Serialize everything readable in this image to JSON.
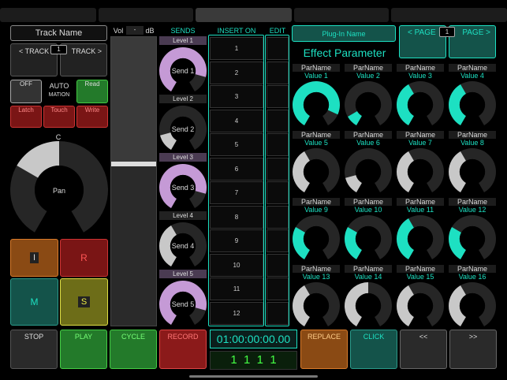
{
  "colors": {
    "accent": "#1de0c2",
    "send": "#c59ad6",
    "play": "#237a2a",
    "record": "#8b1a1a",
    "replace": "#8a4a14",
    "click": "#14534a"
  },
  "track": {
    "name": "Track Name",
    "prev": "< TRACK",
    "next": "TRACK >",
    "number": "1"
  },
  "automation": {
    "off": "OFF",
    "auto1": "AUTO",
    "auto2": "MATION",
    "read": "Read",
    "latch": "Latch",
    "touch": "Touch",
    "write": "Write"
  },
  "pan": {
    "top_label": "C",
    "label": "Pan",
    "value": 0.5
  },
  "channel_buttons": {
    "i": "I",
    "r": "R",
    "m": "M",
    "s": "S"
  },
  "fader": {
    "vol_label": "Vol",
    "value": "-",
    "unit": "dB",
    "level": 0.56
  },
  "sends": {
    "header": "SENDS",
    "items": [
      {
        "level": "Level 1",
        "label": "Send 1",
        "value": 0.85,
        "active": true
      },
      {
        "level": "Level 2",
        "label": "Send 2",
        "value": 0.15,
        "active": false
      },
      {
        "level": "Level 3",
        "label": "Send 3",
        "value": 0.85,
        "active": true
      },
      {
        "level": "Level 4",
        "label": "Send 4",
        "value": 0.4,
        "active": false
      },
      {
        "level": "Level 5",
        "label": "Send 5",
        "value": 0.85,
        "active": true
      }
    ]
  },
  "inserts": {
    "header": "INSERT ON",
    "edit_header": "EDIT",
    "slots": [
      "1",
      "2",
      "3",
      "4",
      "5",
      "6",
      "7",
      "8",
      "9",
      "10",
      "11",
      "12"
    ]
  },
  "plugin": {
    "name": "Plug-In Name",
    "page_prev": "< PAGE",
    "page_num": "1",
    "page_next": "PAGE >",
    "title": "Effect Parameter",
    "params": [
      {
        "name": "ParName",
        "value": "Value 1",
        "level": 0.88,
        "cyan": true
      },
      {
        "name": "ParName",
        "value": "Value 2",
        "level": 0.1,
        "cyan": true
      },
      {
        "name": "ParName",
        "value": "Value 3",
        "level": 0.4,
        "cyan": true
      },
      {
        "name": "ParName",
        "value": "Value 4",
        "level": 0.4,
        "cyan": true
      },
      {
        "name": "ParName",
        "value": "Value 5",
        "level": 0.4,
        "cyan": false
      },
      {
        "name": "ParName",
        "value": "Value 6",
        "level": 0.15,
        "cyan": false
      },
      {
        "name": "ParName",
        "value": "Value 7",
        "level": 0.4,
        "cyan": false
      },
      {
        "name": "ParName",
        "value": "Value 8",
        "level": 0.4,
        "cyan": false
      },
      {
        "name": "ParName",
        "value": "Value 9",
        "level": 0.3,
        "cyan": true
      },
      {
        "name": "ParName",
        "value": "Value 10",
        "level": 0.3,
        "cyan": true
      },
      {
        "name": "ParName",
        "value": "Value 11",
        "level": 0.4,
        "cyan": true
      },
      {
        "name": "ParName",
        "value": "Value 12",
        "level": 0.3,
        "cyan": true
      },
      {
        "name": "ParName",
        "value": "Value 13",
        "level": 0.4,
        "cyan": false
      },
      {
        "name": "ParName",
        "value": "Value 14",
        "level": 0.5,
        "cyan": false
      },
      {
        "name": "ParName",
        "value": "Value 15",
        "level": 0.4,
        "cyan": false
      },
      {
        "name": "ParName",
        "value": "Value 16",
        "level": 0.4,
        "cyan": false
      }
    ]
  },
  "transport": {
    "stop": "STOP",
    "play": "PLAY",
    "cycle": "CYCLE",
    "record": "RECORD",
    "replace": "REPLACE",
    "click": "CLICK",
    "rewind": "<<",
    "forward": ">>",
    "timecode": "01:00:00:00.00",
    "bars": "1  1  1  1"
  }
}
